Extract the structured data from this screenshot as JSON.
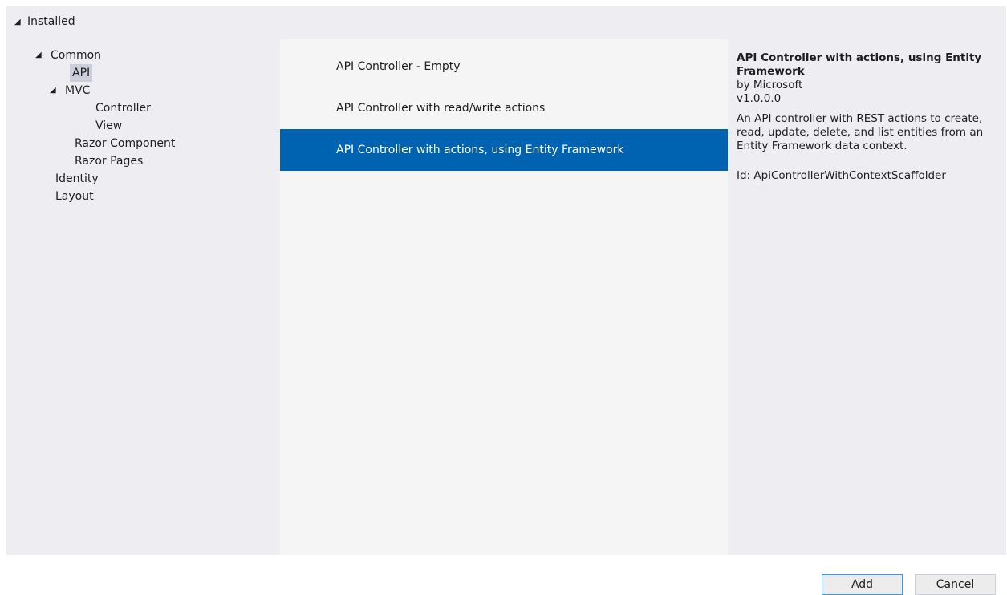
{
  "tree": {
    "root_label": "Installed",
    "items": [
      {
        "label": "Common",
        "expanded": true
      },
      {
        "label": "API",
        "selected": true
      },
      {
        "label": "MVC",
        "expanded": true
      },
      {
        "label": "Controller"
      },
      {
        "label": "View"
      },
      {
        "label": "Razor Component"
      },
      {
        "label": "Razor Pages"
      },
      {
        "label": "Identity"
      },
      {
        "label": "Layout"
      }
    ]
  },
  "templates": [
    {
      "label": "API Controller - Empty"
    },
    {
      "label": "API Controller with read/write actions"
    },
    {
      "label": "API Controller with actions, using Entity Framework",
      "selected": true
    }
  ],
  "details": {
    "title": "API Controller with actions, using Entity Framework",
    "author": "by Microsoft",
    "version": "v1.0.0.0",
    "description": "An API controller with REST actions to create, read, update, delete, and list entities from an Entity Framework data context.",
    "id": "Id: ApiControllerWithContextScaffolder"
  },
  "buttons": {
    "add_label": "Add",
    "cancel_label": "Cancel"
  },
  "colors": {
    "selection": "#0063b1",
    "tree_selection": "#cccedb",
    "panel_background": "#eeeef2"
  }
}
